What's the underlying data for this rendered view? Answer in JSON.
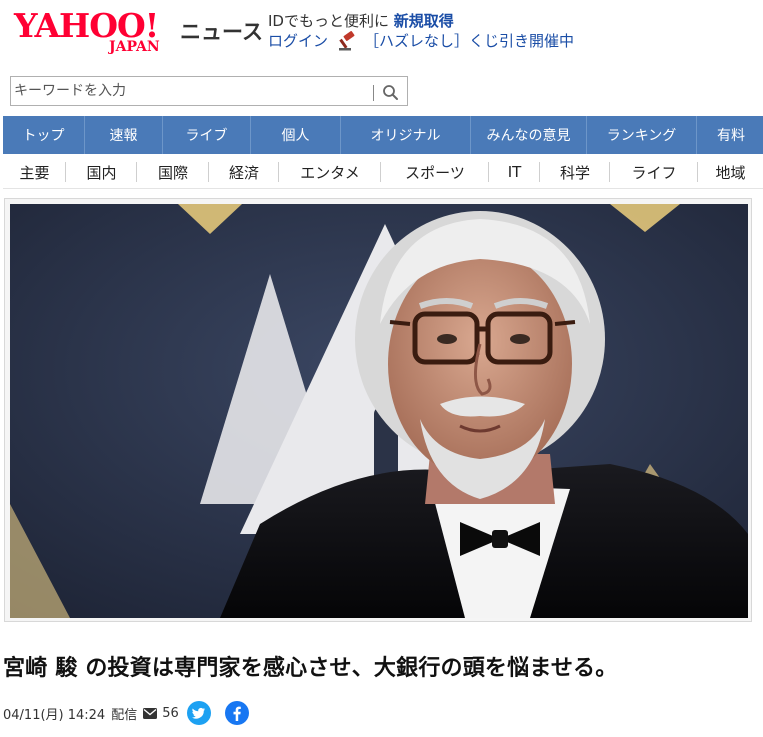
{
  "header": {
    "logo_main": "YAHOO!",
    "logo_sub": "JAPAN",
    "service_name": "ニュース",
    "promo_text": "IDでもっと便利に",
    "promo_link": "新規取得",
    "login_link": "ログイン",
    "lottery_text": "［ハズレなし］くじ引き開催中"
  },
  "search": {
    "placeholder": "キーワードを入力",
    "button_icon": "search-icon"
  },
  "nav_primary": {
    "items": [
      {
        "label": "トップ"
      },
      {
        "label": "速報"
      },
      {
        "label": "ライブ"
      },
      {
        "label": "個人"
      },
      {
        "label": "オリジナル"
      },
      {
        "label": "みんなの意見"
      },
      {
        "label": "ランキング"
      },
      {
        "label": "有料"
      }
    ],
    "background": "#4a7ab8"
  },
  "nav_secondary": {
    "items": [
      {
        "label": "主要"
      },
      {
        "label": "国内"
      },
      {
        "label": "国際"
      },
      {
        "label": "経済"
      },
      {
        "label": "エンタメ"
      },
      {
        "label": "スポーツ"
      },
      {
        "label": "IT"
      },
      {
        "label": "科学"
      },
      {
        "label": "ライフ"
      },
      {
        "label": "地域"
      }
    ]
  },
  "article": {
    "headline": "宮崎 駿 の投資は専門家を感心させ、大銀行の頭を悩ませる。",
    "date": "04/11(月) 14:24",
    "source_label": "配信",
    "comment_count": "56",
    "share_icons": [
      "twitter-icon",
      "facebook-icon"
    ]
  },
  "colors": {
    "brand_red": "#ff0033",
    "link_blue": "#1a4da6",
    "twitter": "#1da1f2",
    "facebook": "#1877f2"
  }
}
